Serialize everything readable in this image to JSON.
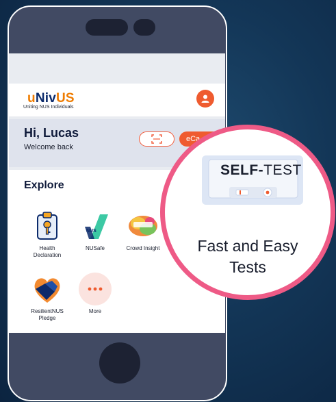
{
  "app": {
    "logo": {
      "part1": "u",
      "part2": "Niv",
      "part3": "US"
    },
    "tagline": "Uniting NUS Individuals"
  },
  "greeting": {
    "title": "Hi, Lucas",
    "subtitle": "Welcome back",
    "ecard_label": "eCa"
  },
  "explore": {
    "title": "Explore",
    "tiles": [
      {
        "label": "Health\nDeclaration",
        "icon": "health-declaration-icon"
      },
      {
        "label": "NUSafe",
        "icon": "nusafe-icon"
      },
      {
        "label": "Crowd Insight",
        "icon": "crowd-insight-icon"
      },
      {
        "label": "ResilientNUS\nPledge",
        "icon": "resilientnus-pledge-icon"
      },
      {
        "label": "More",
        "icon": "more-icon"
      }
    ]
  },
  "callout": {
    "kit_title_bold": "SELF-",
    "kit_title_light": "TEST",
    "caption_line1": "Fast and Easy",
    "caption_line2": "Tests"
  },
  "colors": {
    "background": "#133657",
    "phone_body": "#414a63",
    "accent": "#ef5b2f",
    "bubble_ring": "#ee5a86",
    "navy": "#0b2a6b"
  }
}
